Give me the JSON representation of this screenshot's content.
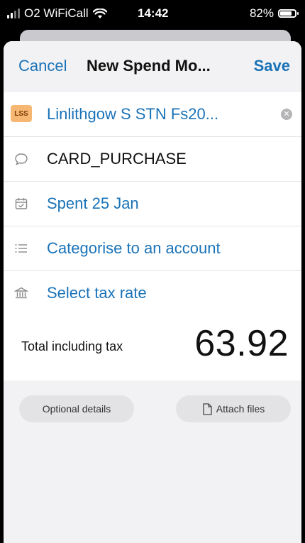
{
  "status": {
    "carrier": "O2 WiFiCall",
    "time": "14:42",
    "battery": "82%",
    "battery_level": 0.82
  },
  "nav": {
    "cancel_label": "Cancel",
    "title": "New Spend Mo...",
    "save_label": "Save"
  },
  "form": {
    "contact": {
      "badge": "LSS",
      "name": "Linlithgow S STN Fs20..."
    },
    "reference": {
      "value": "CARD_PURCHASE"
    },
    "date": {
      "value": "Spent 25 Jan"
    },
    "account": {
      "value": "Categorise to an account"
    },
    "tax": {
      "value": "Select tax rate"
    }
  },
  "total": {
    "label": "Total including tax",
    "amount": "63.92"
  },
  "actions": {
    "optional_label": "Optional details",
    "attach_label": "Attach files"
  },
  "colors": {
    "accent": "#1a73b8",
    "badge": "#f6b772",
    "sheet_bg": "#f2f2f4"
  },
  "icons": {
    "contact": "contact-badge",
    "reference": "speech-bubble-icon",
    "date": "calendar-icon",
    "account": "list-icon",
    "tax": "bank-icon",
    "attach": "document-icon"
  }
}
